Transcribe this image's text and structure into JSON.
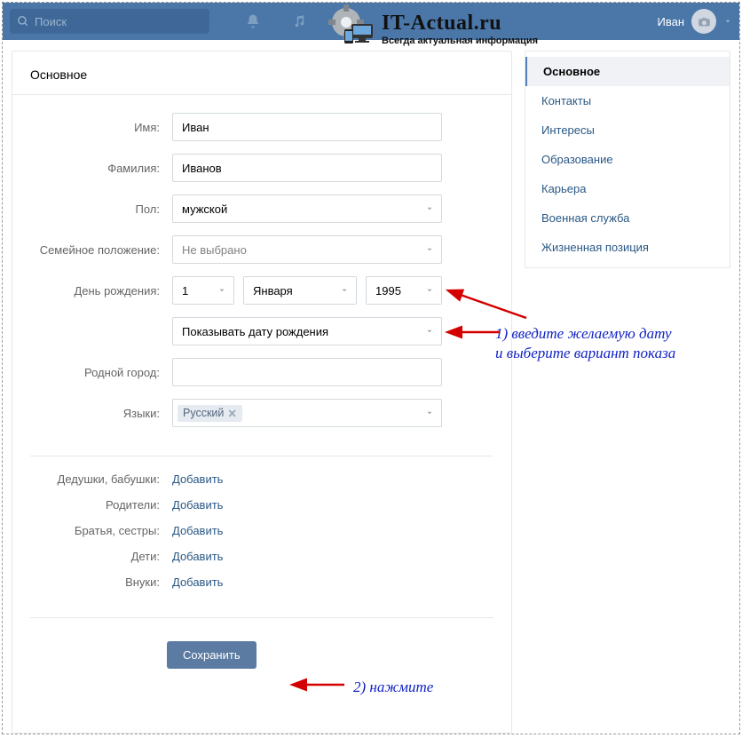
{
  "header": {
    "search_placeholder": "Поиск",
    "user_name": "Иван"
  },
  "watermark": {
    "title": "IT-Actual.ru",
    "subtitle": "Всегда актуальная информация"
  },
  "page_title": "Основное",
  "fields": {
    "name": {
      "label": "Имя:",
      "value": "Иван"
    },
    "surname": {
      "label": "Фамилия:",
      "value": "Иванов"
    },
    "gender": {
      "label": "Пол:",
      "value": "мужской"
    },
    "marital": {
      "label": "Семейное положение:",
      "value": "Не выбрано"
    },
    "birthday": {
      "label": "День рождения:",
      "day": "1",
      "month": "Января",
      "year": "1995",
      "visibility": "Показывать дату рождения"
    },
    "hometown": {
      "label": "Родной город:",
      "value": ""
    },
    "languages": {
      "label": "Языки:",
      "chip": "Русский"
    }
  },
  "family": {
    "grandparents": {
      "label": "Дедушки, бабушки:",
      "link": "Добавить"
    },
    "parents": {
      "label": "Родители:",
      "link": "Добавить"
    },
    "siblings": {
      "label": "Братья, сестры:",
      "link": "Добавить"
    },
    "children": {
      "label": "Дети:",
      "link": "Добавить"
    },
    "grandchildren": {
      "label": "Внуки:",
      "link": "Добавить"
    }
  },
  "save_label": "Сохранить",
  "sidebar": {
    "items": [
      "Основное",
      "Контакты",
      "Интересы",
      "Образование",
      "Карьера",
      "Военная служба",
      "Жизненная позиция"
    ]
  },
  "annotations": {
    "a1_line1": "1) введите желаемую дату",
    "a1_line2": "и выберите вариант показа",
    "a2": "2) нажмите"
  }
}
